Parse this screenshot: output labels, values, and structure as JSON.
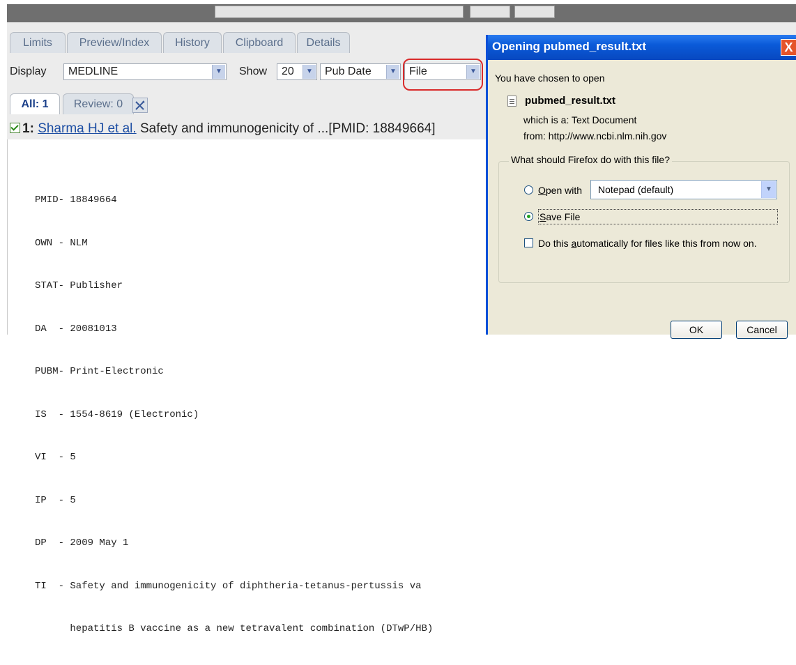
{
  "tabs": [
    {
      "label": "Limits"
    },
    {
      "label": "Preview/Index"
    },
    {
      "label": "History"
    },
    {
      "label": "Clipboard"
    },
    {
      "label": "Details"
    }
  ],
  "display_row": {
    "display_label": "Display",
    "display_value": "MEDLINE",
    "show_label": "Show",
    "show_value": "20",
    "sort_value": "Pub Date",
    "send_value": "File"
  },
  "subtabs": [
    {
      "label": "All: 1"
    },
    {
      "label": "Review: 0"
    }
  ],
  "result": {
    "number": "1:",
    "author": "Sharma HJ et al.",
    "title": " Safety and immunogenicity of ...[PMID: 18849664]"
  },
  "medline_lines": [
    "PMID- 18849664",
    "OWN - NLM",
    "STAT- Publisher",
    "DA  - 20081013",
    "PUBM- Print-Electronic",
    "IS  - 1554-8619 (Electronic)",
    "VI  - 5",
    "IP  - 5",
    "DP  - 2009 May 1",
    "TI  - Safety and immunogenicity of diphtheria-tetanus-pertussis va",
    "      hepatitis B vaccine as a new tetravalent combination (DTwP/HB)"
  ],
  "dialog": {
    "title": "Opening pubmed_result.txt",
    "close": "X",
    "chosen_text": "You have chosen to open",
    "filename": "pubmed_result.txt",
    "which_is": "which is a:  Text Document",
    "from": "from:  http://www.ncbi.nlm.nih.gov",
    "question": "What should Firefox do with this file?",
    "open_with_pre": "",
    "open_with_access": "O",
    "open_with_post": "pen with",
    "open_with_app": "Notepad (default)",
    "save_access": "S",
    "save_post": "ave File",
    "auto_pre": "Do this ",
    "auto_access": "a",
    "auto_post": "utomatically for files like this from now on.",
    "ok": "OK",
    "cancel": "Cancel"
  }
}
